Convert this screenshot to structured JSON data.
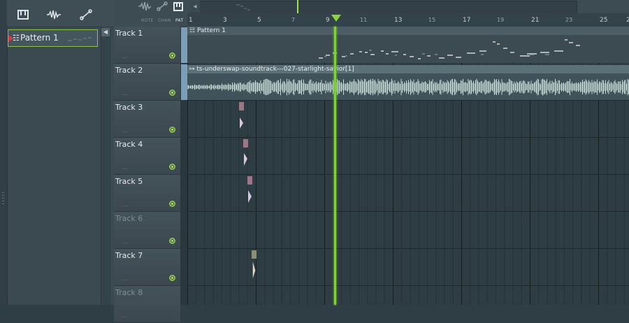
{
  "browser": {
    "top_icons": [
      "piano-roll-icon",
      "audio-wave-icon",
      "automation-icon"
    ],
    "pattern": {
      "label": "Pattern 1",
      "glyph": "☷"
    }
  },
  "playlist": {
    "modes": [
      "NOTE",
      "CHAN",
      "PAT"
    ],
    "ruler": {
      "bars": [
        "1",
        "3",
        "5",
        "7",
        "9",
        "11",
        "13",
        "15",
        "17",
        "19",
        "21",
        "23",
        "25"
      ],
      "last_partial": "2"
    },
    "tracks": [
      {
        "name": "Track 1",
        "empty": false
      },
      {
        "name": "Track 2",
        "empty": false
      },
      {
        "name": "Track 3",
        "empty": false
      },
      {
        "name": "Track 4",
        "empty": false
      },
      {
        "name": "Track 5",
        "empty": false
      },
      {
        "name": "Track 6",
        "empty": true
      },
      {
        "name": "Track 7",
        "empty": false
      },
      {
        "name": "Track 8",
        "empty": true
      }
    ],
    "track_dots": "...",
    "clips": {
      "pattern_clip": "Pattern 1",
      "audio_clip": "ts-underswap-soundtrack---027-starlight-savior[1]"
    }
  },
  "colors": {
    "accent": "#8bc34a",
    "playhead": "#7fd03a",
    "pattern_flag": "#d13d3d"
  }
}
